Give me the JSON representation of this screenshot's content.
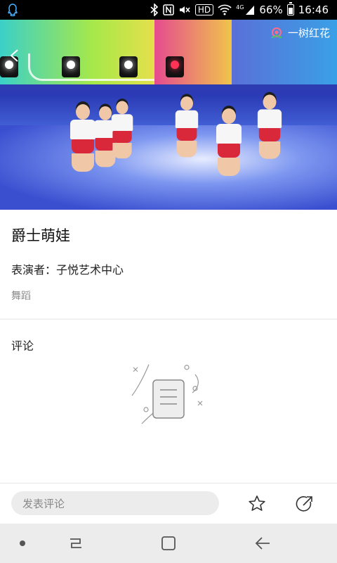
{
  "status_bar": {
    "hd_label": "HD",
    "signal_label": "4G",
    "battery": "66%",
    "time": "16:46",
    "battery_level": 0.66
  },
  "video": {
    "logo_text": "一树红花"
  },
  "program": {
    "title": "爵士萌娃",
    "performer": "表演者：子悦艺术中心",
    "category": "舞蹈"
  },
  "comments": {
    "heading": "评论"
  },
  "bottom_bar": {
    "comment_placeholder": "发表评论"
  },
  "icons": {
    "status": [
      "qq-icon",
      "bluetooth-icon",
      "nfc-icon",
      "mute-icon",
      "wifi-icon",
      "signal-icon",
      "battery-icon"
    ],
    "actions": [
      "star-icon",
      "share-icon"
    ],
    "nav": [
      "recent-apps-icon",
      "home-icon",
      "back-icon"
    ]
  },
  "colors": {
    "accent_red": "#e04a5f",
    "nav_bg": "#ececec"
  }
}
